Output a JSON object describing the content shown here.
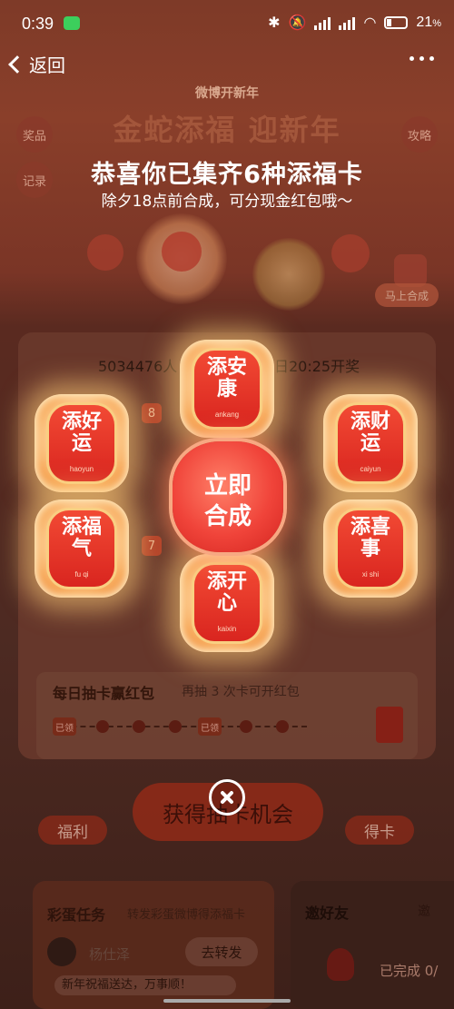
{
  "status_bar": {
    "time": "0:39",
    "battery": "21",
    "battery_unit": "%"
  },
  "nav": {
    "back_label": "返回"
  },
  "background": {
    "subtitle": "微博开新年",
    "title": "金蛇添福 迎新年",
    "left_pills": [
      "奖品",
      "记录"
    ],
    "right_pill": "攻略",
    "merge_shortcut": "马上合成",
    "panel_info_left": "5034476人",
    "panel_info_right": "日20:25开奖",
    "badges": [
      "8",
      "7"
    ],
    "daily": {
      "title": "每日抽卡赢红包",
      "hint": "再抽 3 次卡可开红包",
      "tags": [
        "已领",
        "已领"
      ]
    },
    "main_button": "获得抽卡机会",
    "left_button": "福利",
    "right_button": "得卡",
    "tasks": {
      "title": "彩蛋任务",
      "subtitle": "转发彩蛋微博得添福卡",
      "user": "杨仕泽",
      "forward_button": "去转发",
      "tip": "新年祝福送达，万事顺！"
    },
    "invite": {
      "title": "邀好友",
      "subtitle": "邀",
      "done": "已完成 0/"
    }
  },
  "overlay": {
    "title": "恭喜你已集齐6种添福卡",
    "subtitle": "除夕18点前合成，可分现金红包哦～",
    "cards": [
      {
        "c1": "添安",
        "c2": "康",
        "pinyin": "ankang"
      },
      {
        "c1": "添好",
        "c2": "运",
        "pinyin": "haoyun"
      },
      {
        "c1": "添财",
        "c2": "运",
        "pinyin": "caiyun"
      },
      {
        "c1": "添福",
        "c2": "气",
        "pinyin": "fu qi"
      },
      {
        "c1": "添喜",
        "c2": "事",
        "pinyin": "xi shi"
      },
      {
        "c1": "添开",
        "c2": "心",
        "pinyin": "kaixin"
      }
    ],
    "merge_button": {
      "line1": "立即",
      "line2": "合成"
    }
  }
}
